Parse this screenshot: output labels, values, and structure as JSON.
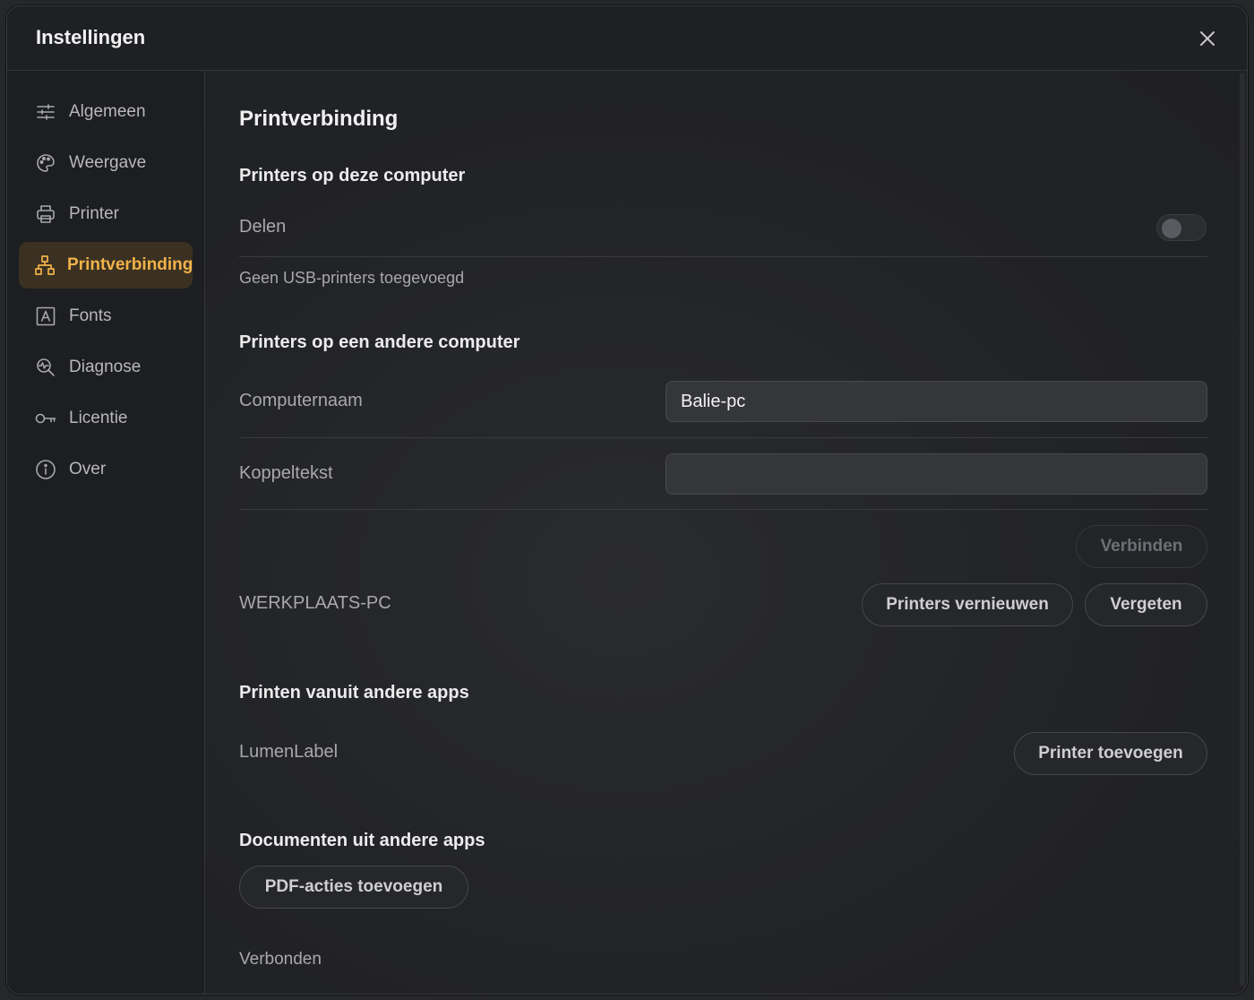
{
  "dialog": {
    "title": "Instellingen"
  },
  "sidebar": {
    "items": [
      {
        "label": "Algemeen",
        "icon": "sliders-icon"
      },
      {
        "label": "Weergave",
        "icon": "palette-icon"
      },
      {
        "label": "Printer",
        "icon": "printer-icon"
      },
      {
        "label": "Printverbinding",
        "icon": "network-icon",
        "active": true
      },
      {
        "label": "Fonts",
        "icon": "font-icon"
      },
      {
        "label": "Diagnose",
        "icon": "diagnose-icon"
      },
      {
        "label": "Licentie",
        "icon": "key-icon"
      },
      {
        "label": "Over",
        "icon": "info-icon"
      }
    ]
  },
  "main": {
    "page_title": "Printverbinding",
    "local": {
      "heading": "Printers op deze computer",
      "share_label": "Delen",
      "share_enabled": false,
      "empty_text": "Geen USB-printers toegevoegd"
    },
    "remote": {
      "heading": "Printers op een andere computer",
      "computer_name_label": "Computernaam",
      "computer_name_value": "Balie-pc",
      "pair_code_label": "Koppeltekst",
      "pair_code_value": "",
      "connect_label": "Verbinden",
      "linked_computer": "WERKPLAATS-PC",
      "refresh_label": "Printers vernieuwen",
      "forget_label": "Vergeten"
    },
    "apps": {
      "heading": "Printen vanuit andere apps",
      "app_name": "LumenLabel",
      "add_printer_label": "Printer toevoegen"
    },
    "documents": {
      "heading": "Documenten uit andere apps",
      "pdf_actions_label": "PDF-acties toevoegen",
      "status": "Verbonden"
    }
  },
  "colors": {
    "accent": "#f2b24a",
    "active_bg": "#3a3122",
    "background": "#202125"
  }
}
